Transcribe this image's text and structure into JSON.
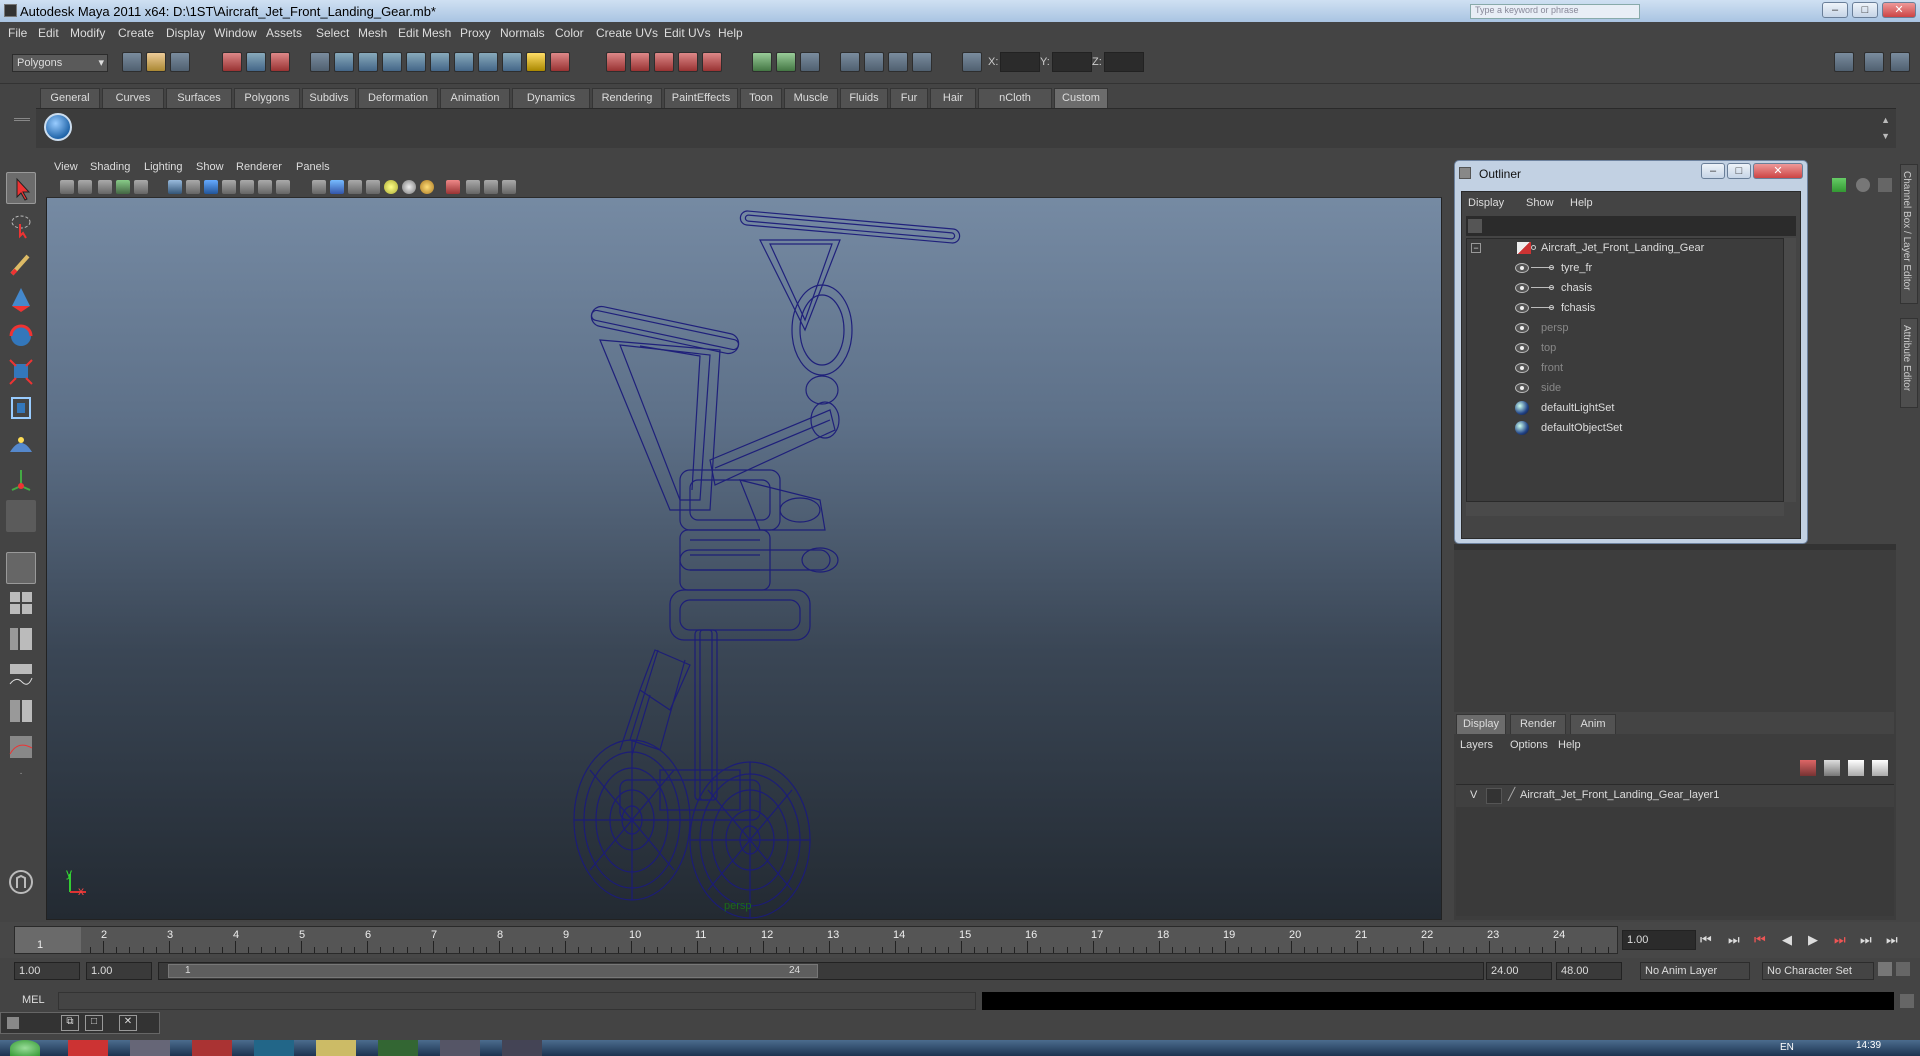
{
  "window": {
    "title": "Autodesk Maya 2011 x64: D:\\1ST\\Aircraft_Jet_Front_Landing_Gear.mb*",
    "search_placeholder": "Type a keyword or phrase"
  },
  "menubar": [
    "File",
    "Edit",
    "Modify",
    "Create",
    "Display",
    "Window",
    "Assets",
    "Select",
    "Mesh",
    "Edit Mesh",
    "Proxy",
    "Normals",
    "Color",
    "Create UVs",
    "Edit UVs",
    "Help"
  ],
  "statusline": {
    "mode": "Polygons",
    "x_label": "X:",
    "y_label": "Y:",
    "z_label": "Z:"
  },
  "shelf_tabs": [
    "General",
    "Curves",
    "Surfaces",
    "Polygons",
    "Subdivs",
    "Deformation",
    "Animation",
    "Dynamics",
    "Rendering",
    "PaintEffects",
    "Toon",
    "Muscle",
    "Fluids",
    "Fur",
    "Hair",
    "nCloth",
    "Custom"
  ],
  "viewport": {
    "menus": [
      "View",
      "Shading",
      "Lighting",
      "Show",
      "Renderer",
      "Panels"
    ],
    "camera_label": "persp",
    "axis_y": "y",
    "axis_x": "x"
  },
  "outliner": {
    "title": "Outliner",
    "menus": [
      "Display",
      "Show",
      "Help"
    ],
    "items": [
      {
        "label": "Aircraft_Jet_Front_Landing_Gear",
        "dim": false,
        "indent": 0
      },
      {
        "label": "tyre_fr",
        "dim": false,
        "indent": 1
      },
      {
        "label": "chasis",
        "dim": false,
        "indent": 1
      },
      {
        "label": "fchasis",
        "dim": false,
        "indent": 1
      },
      {
        "label": "persp",
        "dim": true,
        "indent": 0
      },
      {
        "label": "top",
        "dim": true,
        "indent": 0
      },
      {
        "label": "front",
        "dim": true,
        "indent": 0
      },
      {
        "label": "side",
        "dim": true,
        "indent": 0
      },
      {
        "label": "defaultLightSet",
        "dim": false,
        "indent": 0
      },
      {
        "label": "defaultObjectSet",
        "dim": false,
        "indent": 0
      }
    ]
  },
  "side_tabs": {
    "channel_box": "Channel Box / Layer Editor",
    "attribute_editor": "Attribute Editor"
  },
  "layer_editor": {
    "tabs": [
      "Display",
      "Render",
      "Anim"
    ],
    "menus": [
      "Layers",
      "Options",
      "Help"
    ],
    "layer": {
      "visibility": "V",
      "name": "Aircraft_Jet_Front_Landing_Gear_layer1"
    }
  },
  "timeline": {
    "ticks": [
      "1",
      "2",
      "3",
      "4",
      "5",
      "6",
      "7",
      "8",
      "9",
      "10",
      "11",
      "12",
      "13",
      "14",
      "15",
      "16",
      "17",
      "18",
      "19",
      "20",
      "21",
      "22",
      "23",
      "24"
    ],
    "current_frame": "1",
    "current_time_field": "1.00"
  },
  "range": {
    "start_field": "1.00",
    "playback_start": "1.00",
    "slider_start": "1",
    "slider_end": "24",
    "playback_end": "24.00",
    "end_field": "48.00",
    "anim_layer": "No Anim Layer",
    "character_set": "No Character Set"
  },
  "command": {
    "label": "MEL"
  },
  "taskbar": {
    "clock": "14:39",
    "lang": "EN"
  }
}
